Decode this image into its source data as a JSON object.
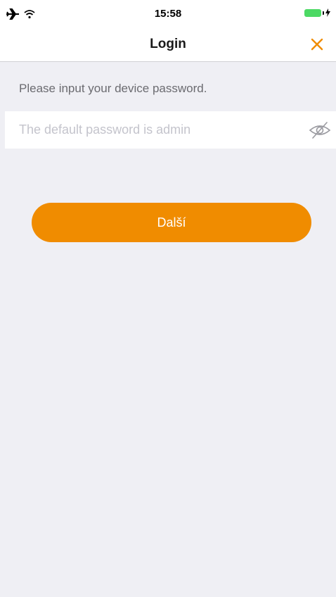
{
  "status_bar": {
    "time": "15:58",
    "icons": [
      "airplane-icon",
      "wifi-icon",
      "battery-icon",
      "charging-icon"
    ]
  },
  "nav": {
    "title": "Login",
    "close_icon": "close-icon"
  },
  "form": {
    "instruction": "Please input your device password.",
    "password_placeholder": "The default password is admin",
    "password_value": "",
    "visibility_icon": "eye-off-icon"
  },
  "next_button": {
    "label": "Další"
  },
  "colors": {
    "accent": "#f08c00",
    "background": "#efeff4",
    "battery": "#4cd964"
  }
}
